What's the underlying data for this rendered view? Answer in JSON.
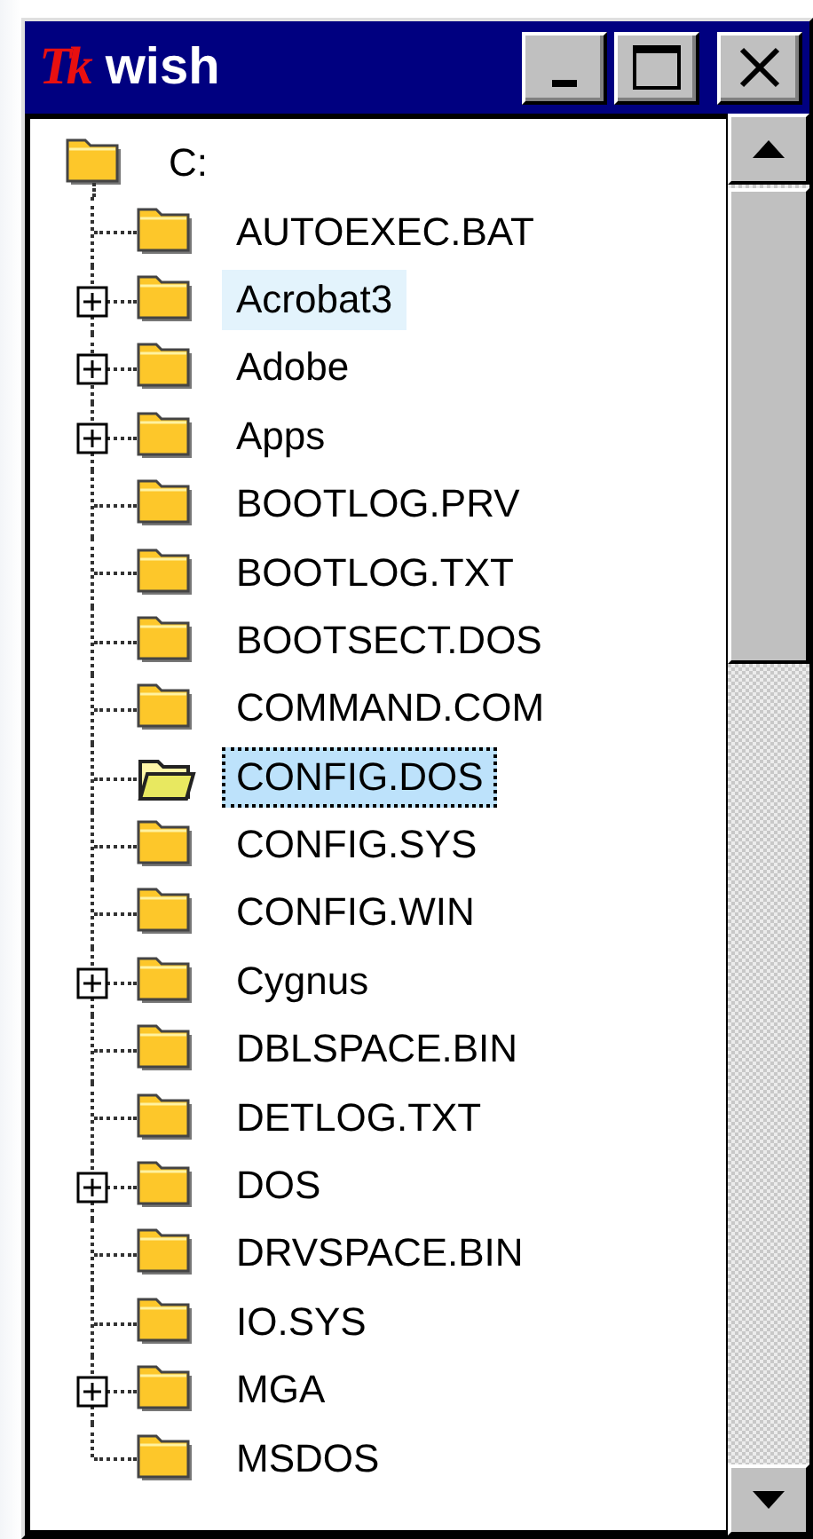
{
  "window": {
    "logo": "Tk",
    "title": "wish"
  },
  "tree": {
    "root": {
      "label": "C:"
    },
    "children": [
      {
        "label": "AUTOEXEC.BAT",
        "expandable": false,
        "highlighted": false,
        "selected": false
      },
      {
        "label": "Acrobat3",
        "expandable": true,
        "highlighted": true,
        "selected": false
      },
      {
        "label": "Adobe",
        "expandable": true,
        "highlighted": false,
        "selected": false
      },
      {
        "label": "Apps",
        "expandable": true,
        "highlighted": false,
        "selected": false
      },
      {
        "label": "BOOTLOG.PRV",
        "expandable": false,
        "highlighted": false,
        "selected": false
      },
      {
        "label": "BOOTLOG.TXT",
        "expandable": false,
        "highlighted": false,
        "selected": false
      },
      {
        "label": "BOOTSECT.DOS",
        "expandable": false,
        "highlighted": false,
        "selected": false
      },
      {
        "label": "COMMAND.COM",
        "expandable": false,
        "highlighted": false,
        "selected": false
      },
      {
        "label": "CONFIG.DOS",
        "expandable": false,
        "highlighted": false,
        "selected": true
      },
      {
        "label": "CONFIG.SYS",
        "expandable": false,
        "highlighted": false,
        "selected": false
      },
      {
        "label": "CONFIG.WIN",
        "expandable": false,
        "highlighted": false,
        "selected": false
      },
      {
        "label": "Cygnus",
        "expandable": true,
        "highlighted": false,
        "selected": false
      },
      {
        "label": "DBLSPACE.BIN",
        "expandable": false,
        "highlighted": false,
        "selected": false
      },
      {
        "label": "DETLOG.TXT",
        "expandable": false,
        "highlighted": false,
        "selected": false
      },
      {
        "label": "DOS",
        "expandable": true,
        "highlighted": false,
        "selected": false
      },
      {
        "label": "DRVSPACE.BIN",
        "expandable": false,
        "highlighted": false,
        "selected": false
      },
      {
        "label": "IO.SYS",
        "expandable": false,
        "highlighted": false,
        "selected": false
      },
      {
        "label": "MGA",
        "expandable": true,
        "highlighted": false,
        "selected": false
      },
      {
        "label": "MSDOS",
        "expandable": false,
        "highlighted": false,
        "selected": false
      }
    ]
  }
}
